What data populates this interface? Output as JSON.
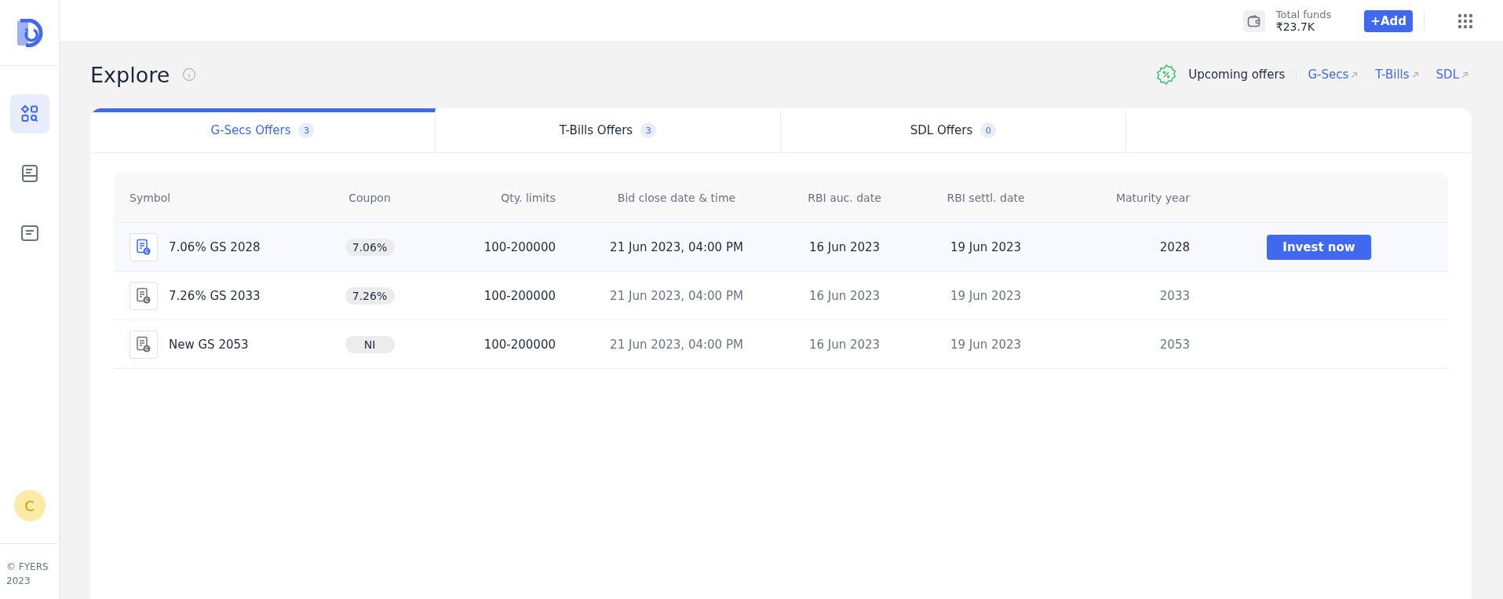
{
  "sidebar": {
    "nav_items": [
      {
        "kind": "explore",
        "selected": true
      },
      {
        "kind": "orders",
        "selected": false
      },
      {
        "kind": "notes",
        "selected": false
      }
    ],
    "avatar": "C",
    "footer": "© FYERS 2023"
  },
  "header": {
    "funds_label": "Total funds",
    "funds_value": "₹23.7K",
    "add_button": "+Add"
  },
  "page": {
    "title": "Explore",
    "upcoming_label": "Upcoming offers",
    "links": [
      "G-Secs",
      "T-Bills",
      "SDL"
    ]
  },
  "tabs": [
    {
      "label": "G-Secs Offers",
      "count": "3",
      "selected": true
    },
    {
      "label": "T-Bills Offers",
      "count": "3",
      "selected": false
    },
    {
      "label": "SDL Offers",
      "count": "0",
      "selected": false
    }
  ],
  "table": {
    "columns": [
      "Symbol",
      "Coupon",
      "Qty. limits",
      "Bid close date & time",
      "RBI auc. date",
      "RBI settl. date",
      "Maturity year"
    ],
    "rows": [
      {
        "selected": true,
        "symbol": "7.06% GS 2028",
        "coupon": "7.06%",
        "qty": "100-200000",
        "bid_close": "21 Jun 2023, 04:00 PM",
        "auction": "16 Jun 2023",
        "settlement": "19 Jun 2023",
        "maturity": "2028",
        "action": "Invest now"
      },
      {
        "selected": false,
        "symbol": "7.26% GS 2033",
        "coupon": "7.26%",
        "qty": "100-200000",
        "bid_close": "21 Jun 2023, 04:00 PM",
        "auction": "16 Jun 2023",
        "settlement": "19 Jun 2023",
        "maturity": "2033"
      },
      {
        "selected": false,
        "symbol": "New GS 2053",
        "coupon": "NI",
        "qty": "100-200000",
        "bid_close": "21 Jun 2023, 04:00 PM",
        "auction": "16 Jun 2023",
        "settlement": "19 Jun 2023",
        "maturity": "2053"
      }
    ]
  }
}
